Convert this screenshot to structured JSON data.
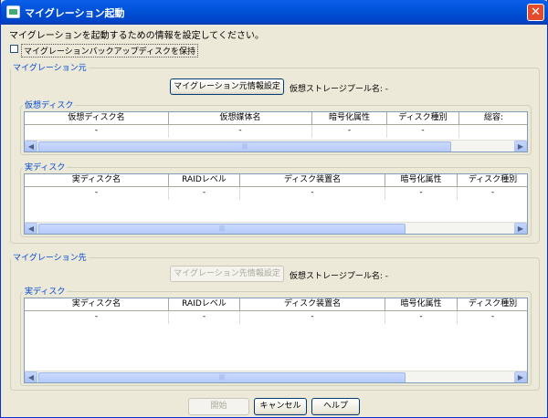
{
  "window": {
    "title": "マイグレーション起動"
  },
  "instruction": "マイグレーションを起動するための情報を設定してください。",
  "backup_checkbox": {
    "label": "マイグレーションバックアップディスクを保持",
    "checked": false
  },
  "source": {
    "group_label": "マイグレーション元",
    "info_button": "マイグレーション元情報設定",
    "pool_label": "仮想ストレージプール名: -",
    "virtual_disk": {
      "group_label": "仮想ディスク",
      "columns": [
        "仮想ディスク名",
        "仮想媒体名",
        "暗号化属性",
        "ディスク種別",
        "総容:"
      ],
      "row": [
        "-",
        "-",
        "-",
        "-",
        ""
      ]
    },
    "real_disk": {
      "group_label": "実ディスク",
      "columns": [
        "実ディスク名",
        "RAIDレベル",
        "ディスク装置名",
        "暗号化属性",
        "ディスク種別"
      ],
      "row": [
        "-",
        "-",
        "-",
        "-",
        "-"
      ]
    }
  },
  "dest": {
    "group_label": "マイグレーション先",
    "info_button": "マイグレーション先情報設定",
    "pool_label": "仮想ストレージプール名: -",
    "real_disk": {
      "group_label": "実ディスク",
      "columns": [
        "実ディスク名",
        "RAIDレベル",
        "ディスク装置名",
        "暗号化属性",
        "ディスク種別"
      ],
      "row": [
        "-",
        "-",
        "-",
        "-",
        "-"
      ]
    }
  },
  "buttons": {
    "start": "開始",
    "cancel": "キャンセル",
    "help": "ヘルプ"
  },
  "icons": {
    "left": "◀",
    "right": "▶",
    "grip": "|||"
  }
}
